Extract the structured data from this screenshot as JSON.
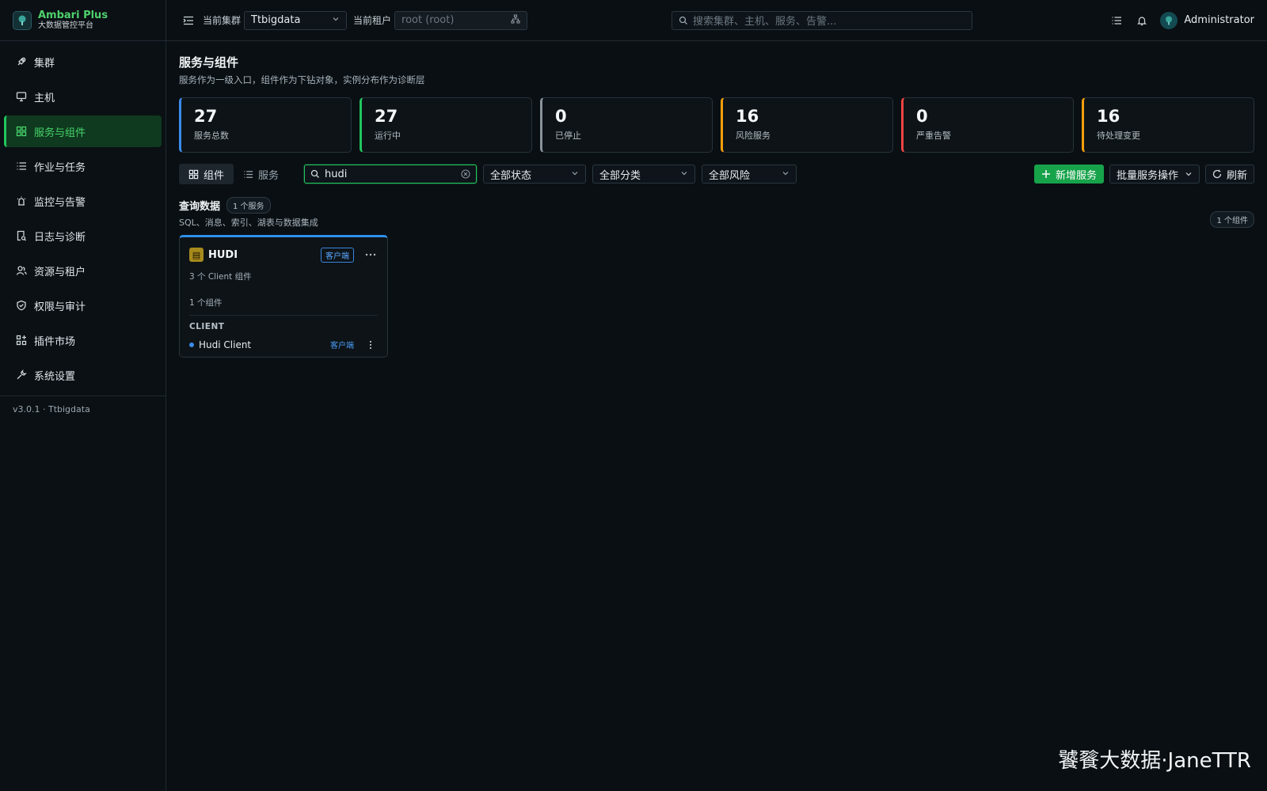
{
  "brand": {
    "name": "Ambari Plus",
    "subtitle": "大数据管控平台"
  },
  "sidebar": {
    "items": [
      {
        "label": "集群",
        "icon": "rocket-icon"
      },
      {
        "label": "主机",
        "icon": "monitor-icon"
      },
      {
        "label": "服务与组件",
        "icon": "grid-icon",
        "active": true
      },
      {
        "label": "作业与任务",
        "icon": "list-icon"
      },
      {
        "label": "监控与告警",
        "icon": "alarm-icon"
      },
      {
        "label": "日志与诊断",
        "icon": "file-search-icon"
      },
      {
        "label": "资源与租户",
        "icon": "users-icon"
      },
      {
        "label": "权限与审计",
        "icon": "shield-check-icon"
      },
      {
        "label": "插件市场",
        "icon": "apps-icon"
      },
      {
        "label": "系统设置",
        "icon": "wrench-icon"
      }
    ],
    "version": "v3.0.1 · Ttbigdata"
  },
  "header": {
    "cluster_label": "当前集群",
    "cluster_value": "Ttbigdata",
    "tenant_label": "当前租户",
    "tenant_value": "root (root)",
    "search_placeholder": "搜索集群、主机、服务、告警...",
    "username": "Administrator"
  },
  "page": {
    "title": "服务与组件",
    "subtitle": "服务作为一级入口，组件作为下钻对象，实例分布作为诊断层"
  },
  "stats": [
    {
      "value": "27",
      "label": "服务总数",
      "color": "#3b8bea"
    },
    {
      "value": "27",
      "label": "运行中",
      "color": "#22c55e"
    },
    {
      "value": "0",
      "label": "已停止",
      "color": "#8a949b"
    },
    {
      "value": "16",
      "label": "风险服务",
      "color": "#f59e0b"
    },
    {
      "value": "0",
      "label": "严重告警",
      "color": "#ef4444"
    },
    {
      "value": "16",
      "label": "待处理变更",
      "color": "#f59e0b"
    }
  ],
  "toolbar": {
    "view_components": "组件",
    "view_services": "服务",
    "search_value": "hudi",
    "filter_status": "全部状态",
    "filter_category": "全部分类",
    "filter_risk": "全部风险",
    "add_service": "新增服务",
    "batch_ops": "批量服务操作",
    "refresh": "刷新"
  },
  "group": {
    "title": "查询数据",
    "service_count": "1 个服务",
    "description": "SQL、消息、索引、湖表与数据集成",
    "component_count": "1 个组件"
  },
  "card": {
    "icon_glyph": "▤",
    "name": "HUDI",
    "badge": "客户端",
    "desc": "3 个 Client 组件",
    "count": "1 个组件",
    "category": "CLIENT",
    "component": {
      "name": "Hudi Client",
      "tag": "客户端"
    }
  },
  "watermark": "饕餮大数据·JaneTTR"
}
